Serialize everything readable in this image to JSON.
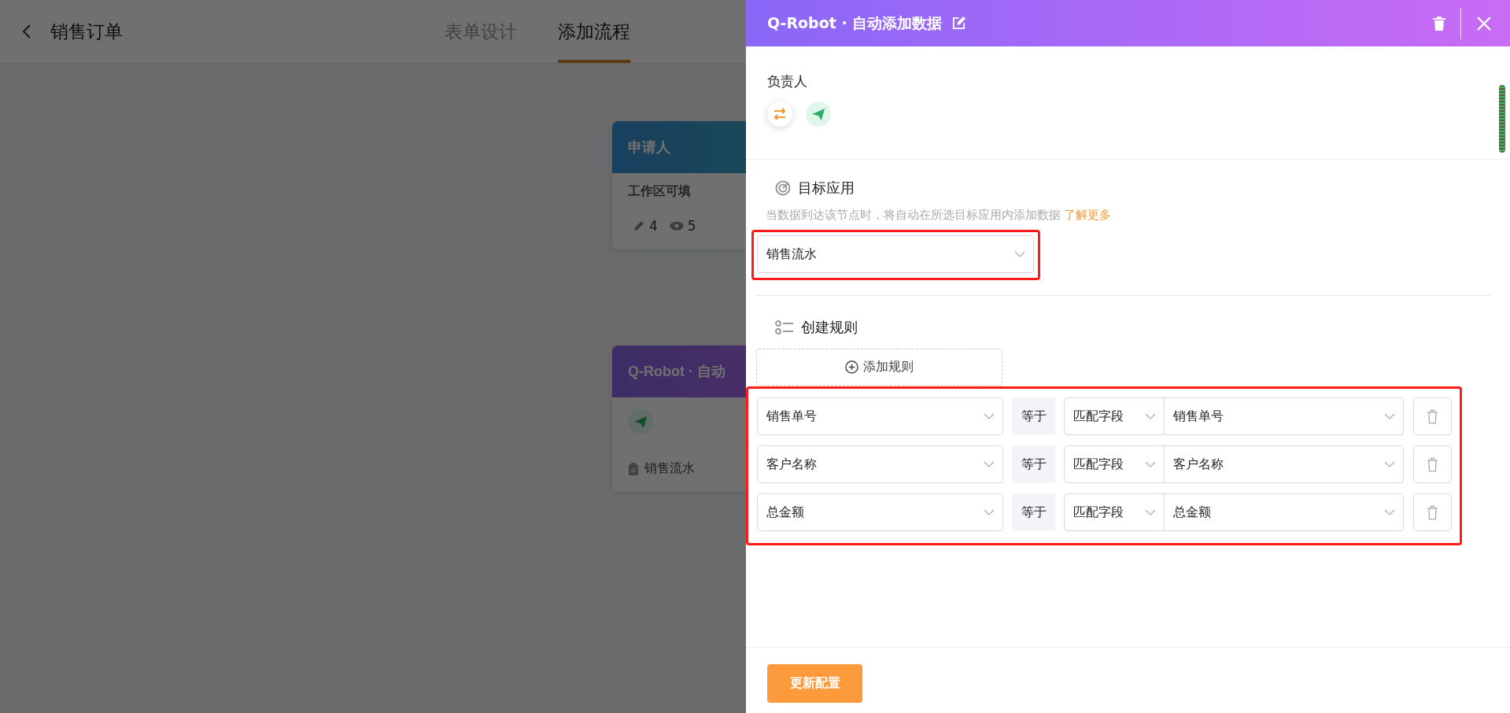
{
  "page": {
    "title": "销售订单",
    "tabs": [
      {
        "label": "表单设计",
        "selected": false
      },
      {
        "label": "添加流程",
        "selected": true
      }
    ]
  },
  "canvas": {
    "nodes": [
      {
        "kind": "applicant",
        "title": "申请人",
        "permission": "工作区可填",
        "edit_count": "4",
        "view_count": "5"
      },
      {
        "kind": "robot",
        "title": "Q-Robot · 自动",
        "target": "销售流水"
      }
    ]
  },
  "drawer": {
    "title": "Q-Robot · 自动添加数据",
    "owner": {
      "label": "负责人"
    },
    "target": {
      "title": "目标应用",
      "description": "当数据到达该节点时，将自动在所选目标应用内添加数据",
      "link": "了解更多",
      "value": "销售流水"
    },
    "rules": {
      "title": "创建规则",
      "add_label": "添加规则",
      "rows": [
        {
          "field": "销售单号",
          "operator": "等于",
          "mode": "匹配字段",
          "value": "销售单号"
        },
        {
          "field": "客户名称",
          "operator": "等于",
          "mode": "匹配字段",
          "value": "客户名称"
        },
        {
          "field": "总金额",
          "operator": "等于",
          "mode": "匹配字段",
          "value": "总金额"
        }
      ]
    },
    "submit": "更新配置"
  }
}
